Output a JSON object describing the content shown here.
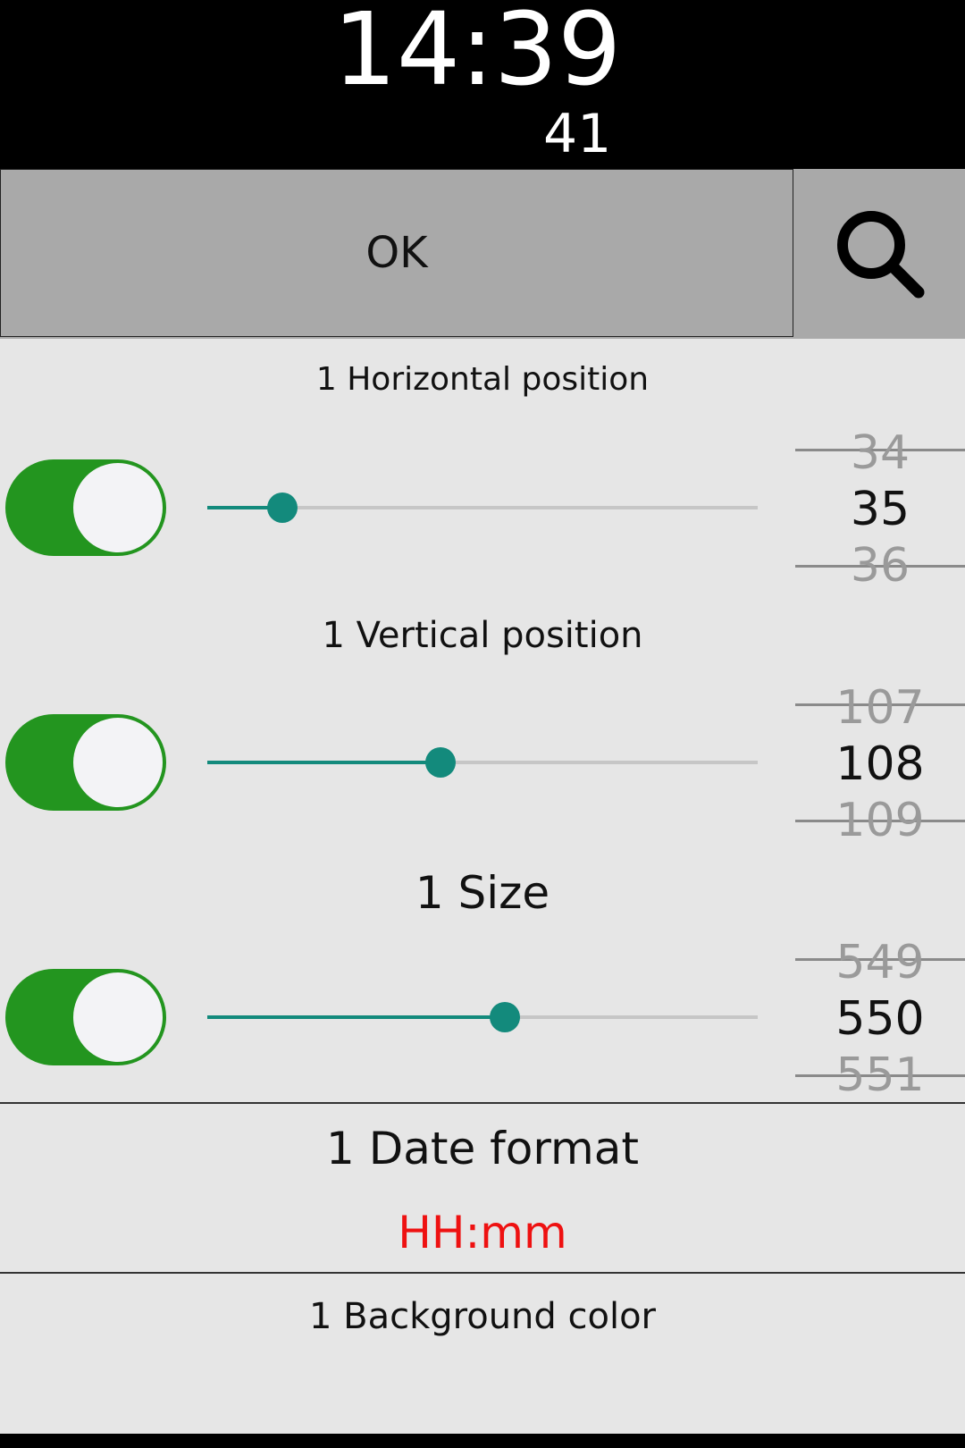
{
  "preview": {
    "time": "14:39",
    "seconds": "41"
  },
  "toolbar": {
    "ok_label": "OK",
    "search_icon": "search-icon"
  },
  "settings": [
    {
      "title": "1 Horizontal position",
      "enabled": true,
      "slider_fraction": 0.137,
      "picker": {
        "prev": "34",
        "current": "35",
        "next": "36"
      }
    },
    {
      "title": "1 Vertical position",
      "enabled": true,
      "slider_fraction": 0.423,
      "picker": {
        "prev": "107",
        "current": "108",
        "next": "109"
      }
    },
    {
      "title": "1 Size",
      "enabled": true,
      "slider_fraction": 0.54,
      "picker": {
        "prev": "549",
        "current": "550",
        "next": "551"
      }
    }
  ],
  "date_format": {
    "title": "1 Date format",
    "value": "HH:mm",
    "value_color": "#ee1111"
  },
  "background": {
    "title": "1 Background color"
  },
  "colors": {
    "toggle_on": "#23951f",
    "accent": "#138a7c"
  }
}
